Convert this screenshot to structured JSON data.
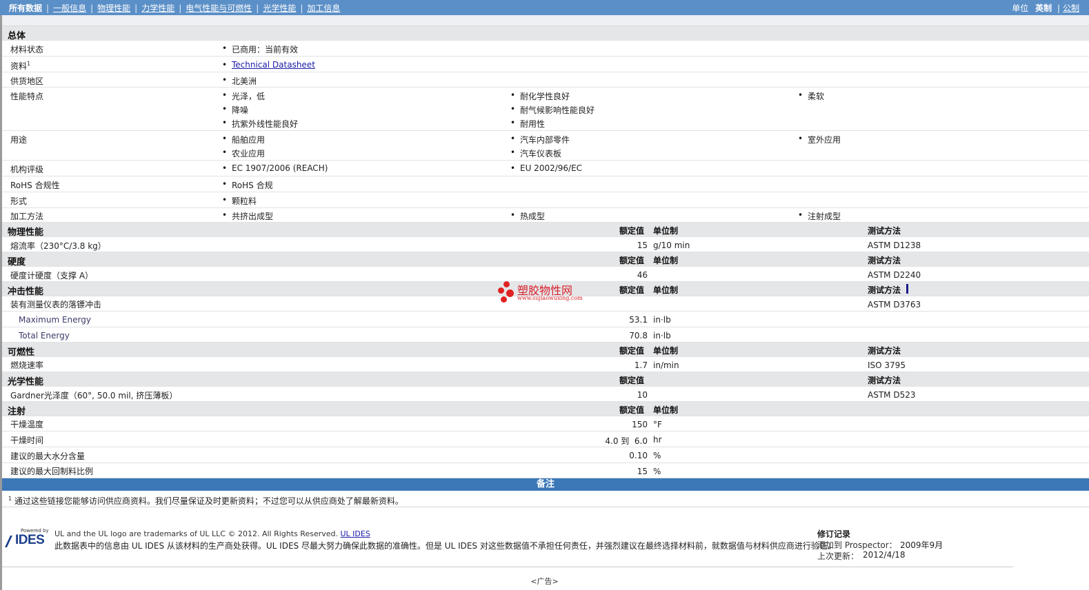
{
  "nav": {
    "current": "所有数据",
    "items": [
      "一般信息",
      "物理性能",
      "力学性能",
      "电气性能与可燃性",
      "光学性能",
      "加工信息"
    ],
    "units_label": "单位",
    "unit_selected": "英制",
    "unit_other": "公制"
  },
  "general": {
    "title": "总体",
    "material_status_label": "材料状态",
    "material_status_value": "已商用：当前有效",
    "resources_label": "资料",
    "resources_sup": "1",
    "resources_link": "Technical Datasheet",
    "region_label": "供货地区",
    "region_value": "北美洲",
    "features_label": "性能特点",
    "features": [
      "光泽，低",
      "耐化学性良好",
      "柔软",
      "降噪",
      "耐气候影响性能良好",
      "抗紫外线性能良好",
      "耐用性"
    ],
    "uses_label": "用途",
    "uses": [
      "船舶应用",
      "汽车内部零件",
      "室外应用",
      "农业应用",
      "汽车仪表板"
    ],
    "agency_label": "机构评级",
    "agency": [
      "EC 1907/2006 (REACH)",
      "EU 2002/96/EC"
    ],
    "rohs_label": "RoHS 合规性",
    "rohs_value": "RoHS 合规",
    "form_label": "形式",
    "form_value": "颗粒料",
    "processing_label": "加工方法",
    "processing": [
      "共挤出成型",
      "热成型",
      "注射成型"
    ]
  },
  "headers": {
    "nominal": "额定值",
    "unit": "单位制",
    "method": "测试方法"
  },
  "physical": {
    "title": "物理性能",
    "rows": [
      {
        "label": "熔流率（230°C/3.8 kg）",
        "value": "15",
        "unit": "g/10 min",
        "method": "ASTM D1238"
      }
    ]
  },
  "hardness": {
    "title": "硬度",
    "rows": [
      {
        "label": "硬度计硬度（支撑 A）",
        "value": "46",
        "unit": "",
        "method": "ASTM D2240"
      }
    ]
  },
  "impact": {
    "title": "冲击性能",
    "parent_label": "装有测量仪表的落镖冲击",
    "parent_method": "ASTM D3763",
    "rows": [
      {
        "label": "Maximum Energy",
        "value": "53.1",
        "unit": "in·lb"
      },
      {
        "label": "Total Energy",
        "value": "70.8",
        "unit": "in·lb"
      }
    ]
  },
  "flammability": {
    "title": "可燃性",
    "rows": [
      {
        "label": "燃烧速率",
        "value": "1.7",
        "unit": "in/min",
        "method": "ISO 3795"
      }
    ]
  },
  "optical": {
    "title": "光学性能",
    "rows": [
      {
        "label": "Gardner光泽度（60°, 50.0 mil, 挤压薄板）",
        "value": "10",
        "unit": "",
        "method": "ASTM D523"
      }
    ]
  },
  "injection": {
    "title": "注射",
    "rows": [
      {
        "label": "干燥温度",
        "value": "150",
        "unit": "°F"
      },
      {
        "label": "干燥时间",
        "value": "4.0 到  6.0",
        "unit": "hr"
      },
      {
        "label": "建议的最大水分含量",
        "value": "0.10",
        "unit": "%"
      },
      {
        "label": "建议的最大回制料比例",
        "value": "15",
        "unit": "%"
      }
    ]
  },
  "notes": {
    "title": "备注",
    "footnote_num": "1",
    "footnote_text": "通过这些链接您能够访问供应商资料。我们尽量保证及时更新资料；不过您可以从供应商处了解最新资料。"
  },
  "watermark": {
    "text": "塑胶物性网",
    "url": "www.sujiaowuxing.com"
  },
  "footer": {
    "powered_by": "Powered by",
    "logo_text": "IDES",
    "trademark": "UL and the UL logo are trademarks of UL LLC © 2012. All Rights Reserved.",
    "trademark_link": "UL IDES",
    "disclaimer": "此数据表中的信息由  UL IDES 从该材料的生产商处获得。UL IDES 尽最大努力确保此数据的准确性。但是  UL IDES 对这些数据值不承担任何责任，并强烈建议在最终选择材料前，就数据值与材料供应商进行验证。",
    "revision_title": "修订记录",
    "added_label": "添加到  Prospector：",
    "added_value": "2009年9月",
    "updated_label": "上次更新：",
    "updated_value": "2012/4/18",
    "ad": "<广告>"
  },
  "colors": {
    "nav_bar": "#5b8fc7",
    "section_bg": "#e5e6e8",
    "notes_bar": "#3c78b8",
    "link": "#1a1aa8",
    "watermark": "#d8202a"
  }
}
